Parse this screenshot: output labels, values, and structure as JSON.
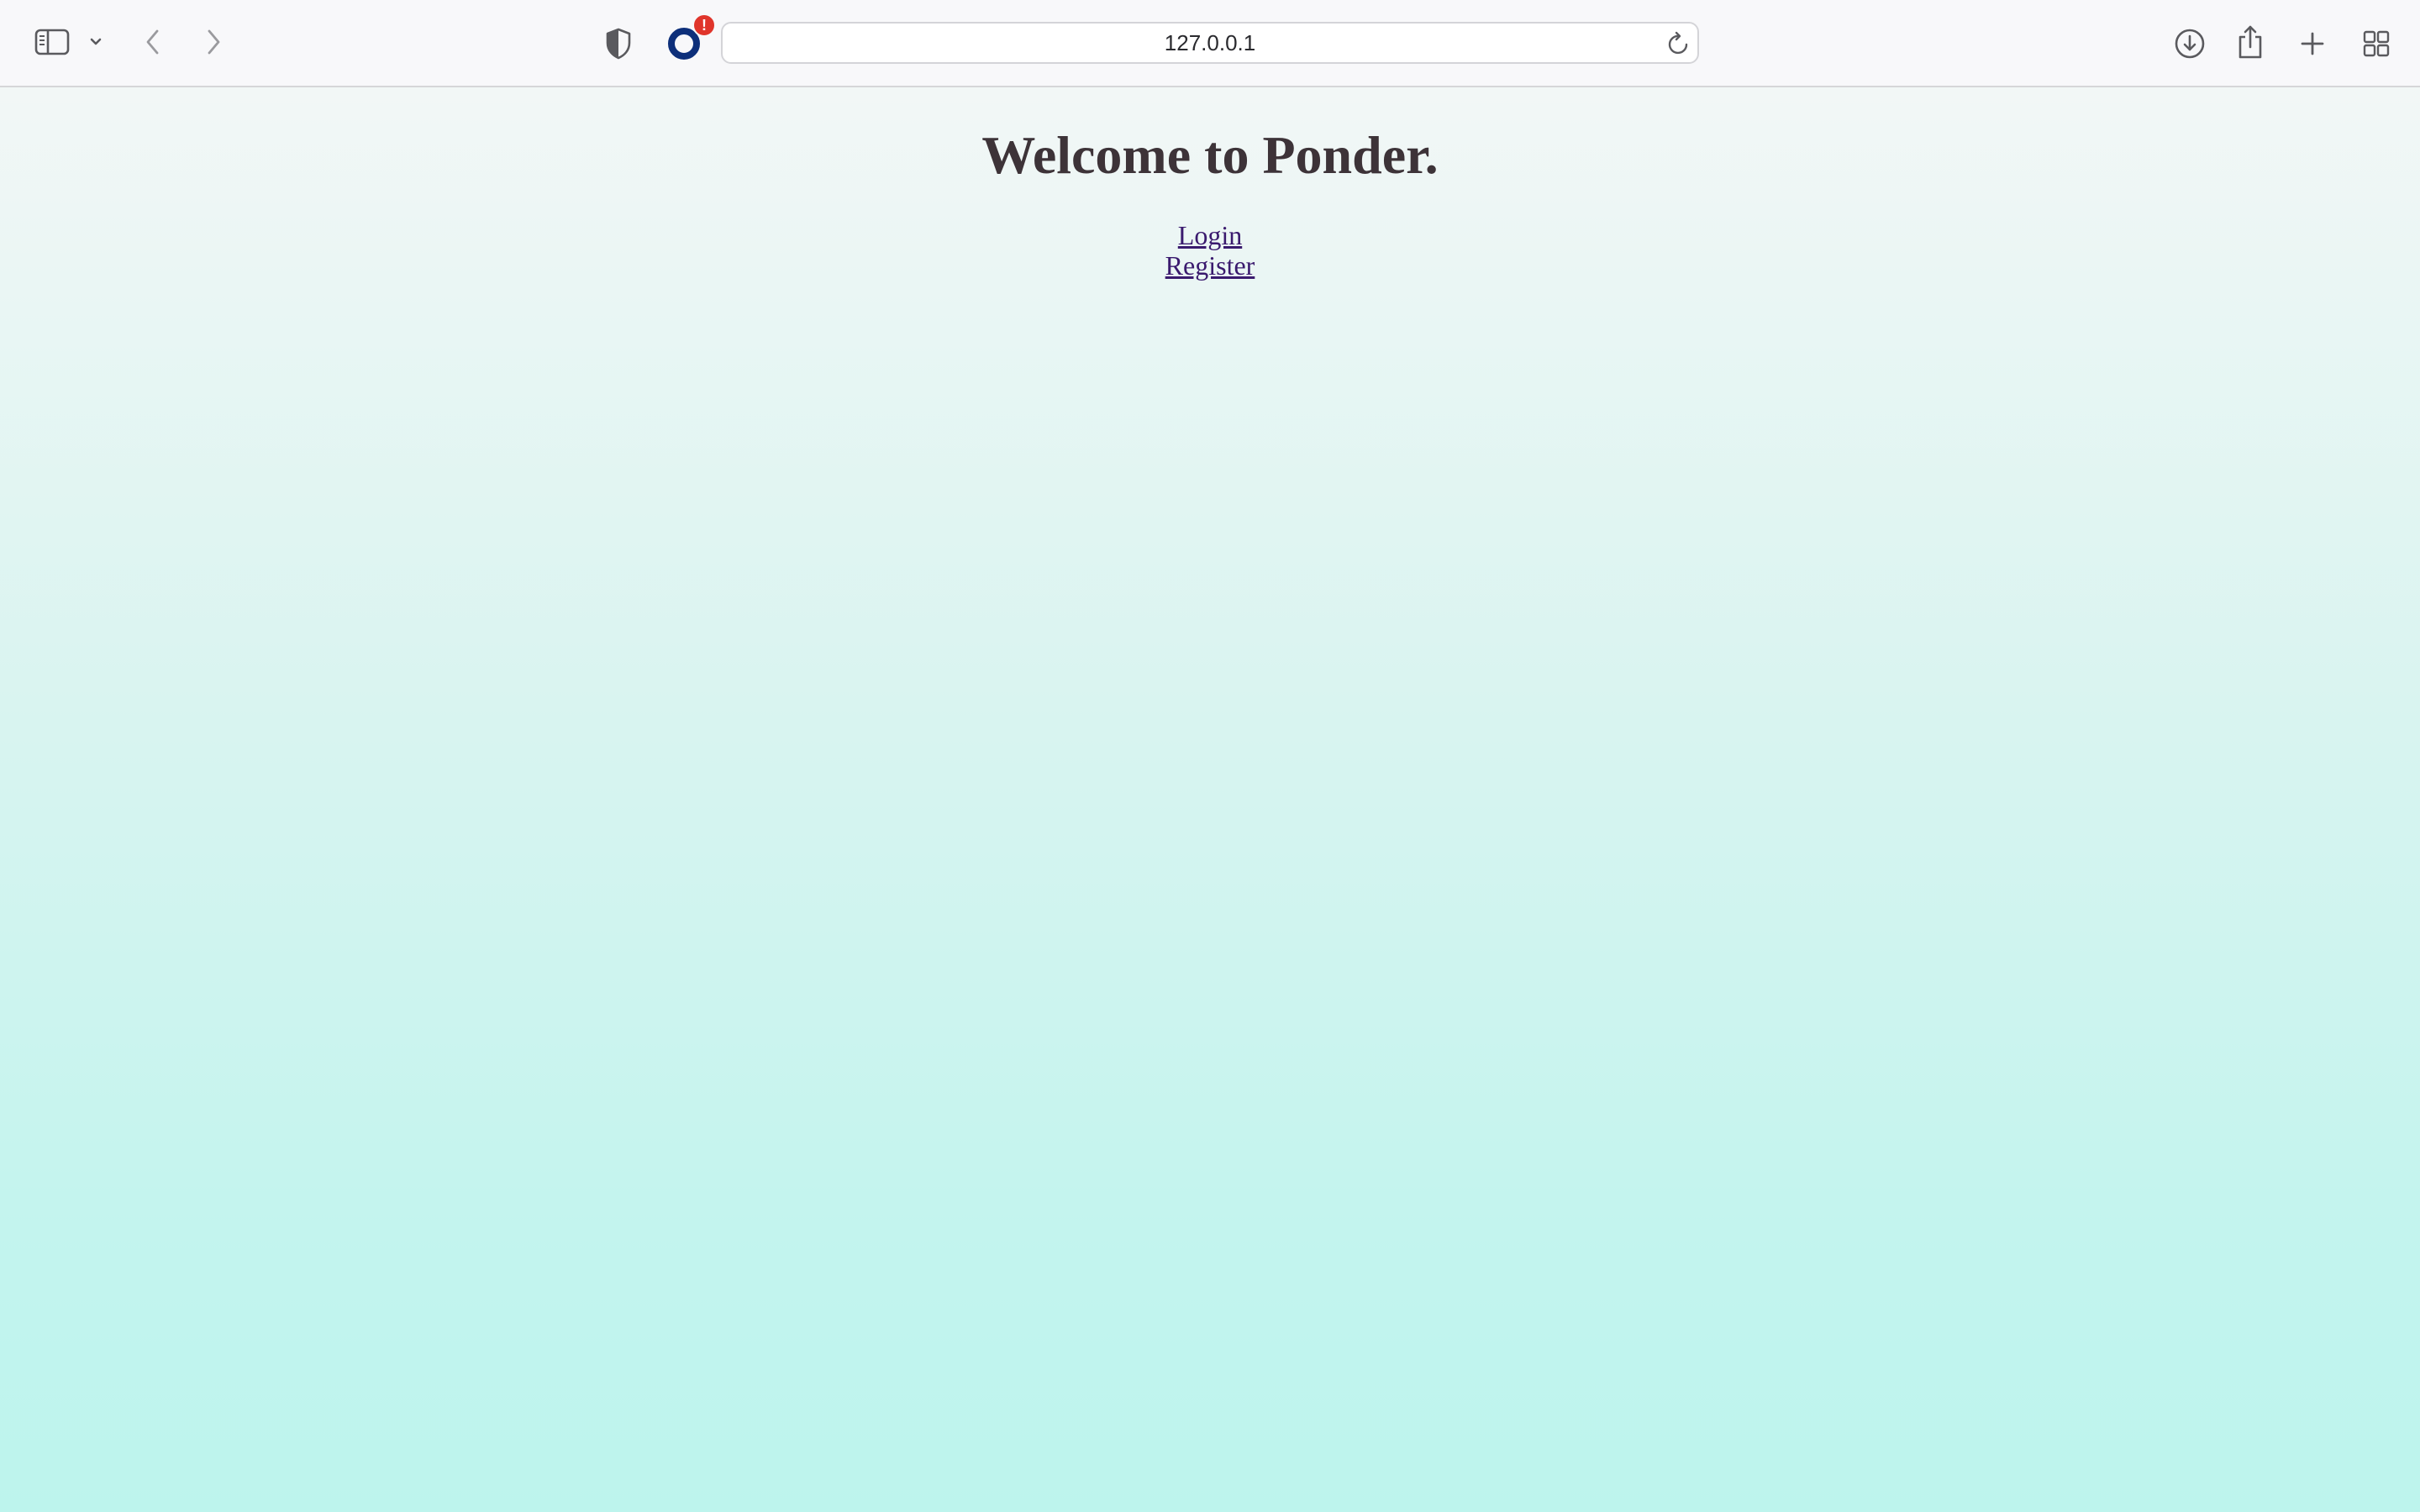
{
  "browser": {
    "address": "127.0.0.1",
    "extension_badge": "!",
    "icons": {
      "sidebar": "sidebar-icon",
      "sidebar_menu": "chevron-down-icon",
      "back": "chevron-left-icon",
      "forward": "chevron-right-icon",
      "privacy": "shield-icon",
      "extension": "ring-extension-icon",
      "reload": "reload-icon",
      "downloads": "download-icon",
      "share": "share-icon",
      "new_tab": "plus-icon",
      "tab_overview": "grid-icon"
    }
  },
  "page": {
    "title": "Welcome to Ponder.",
    "links": [
      {
        "label": "Login"
      },
      {
        "label": "Register"
      }
    ]
  },
  "colors": {
    "title_text": "#3d3338",
    "link": "#3a1a6e",
    "badge": "#e0352b",
    "extension_ring": "#0d2f7a",
    "background_top": "#f2f7f6",
    "background_bottom": "#bdf4ed"
  }
}
